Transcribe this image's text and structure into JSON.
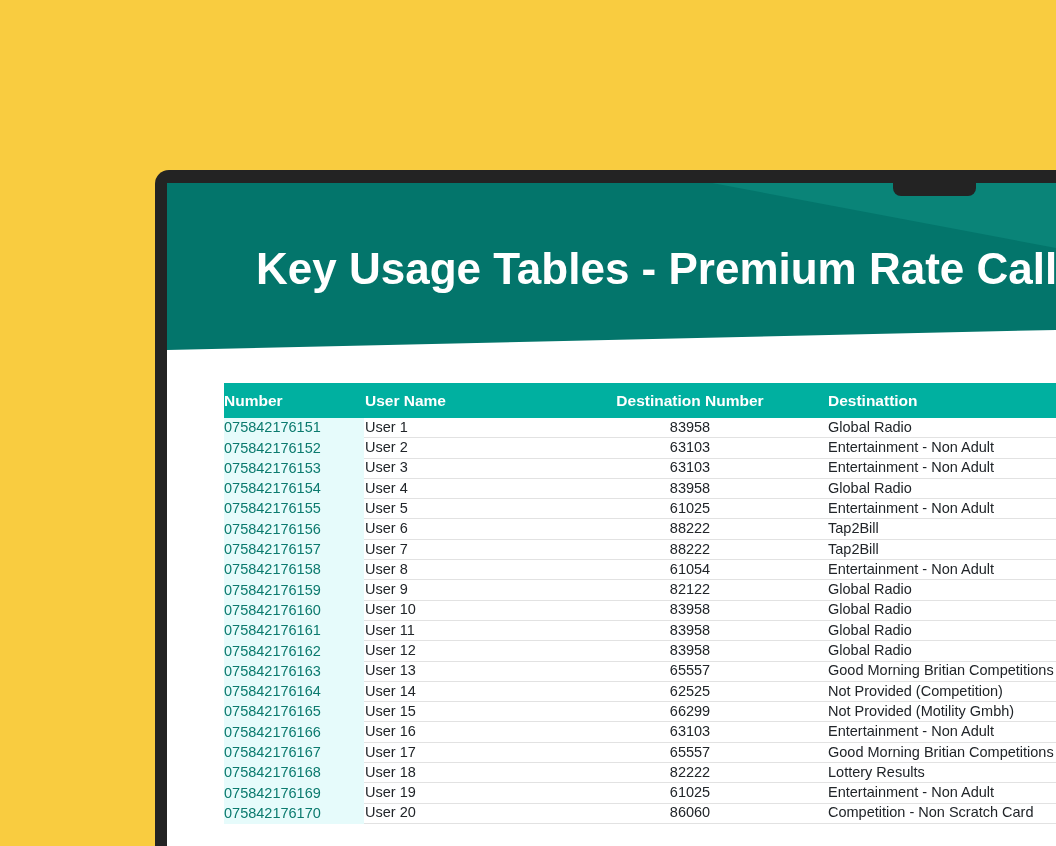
{
  "report": {
    "title": "Key Usage Tables - Premium Rate Call"
  },
  "table": {
    "columns": [
      "Number",
      "User Name",
      "Destination Number",
      "Destinattion"
    ],
    "rows": [
      [
        "075842176151",
        "User 1",
        "83958",
        "Global Radio"
      ],
      [
        "075842176152",
        "User 2",
        "63103",
        "Entertainment - Non Adult"
      ],
      [
        "075842176153",
        "User 3",
        "63103",
        "Entertainment - Non Adult"
      ],
      [
        "075842176154",
        "User 4",
        "83958",
        "Global Radio"
      ],
      [
        "075842176155",
        "User 5",
        "61025",
        "Entertainment - Non Adult"
      ],
      [
        "075842176156",
        "User 6",
        "88222",
        "Tap2Bill"
      ],
      [
        "075842176157",
        "User 7",
        "88222",
        "Tap2Bill"
      ],
      [
        "075842176158",
        "User 8",
        "61054",
        "Entertainment - Non Adult"
      ],
      [
        "075842176159",
        "User 9",
        "82122",
        "Global Radio"
      ],
      [
        "075842176160",
        "User 10",
        "83958",
        "Global Radio"
      ],
      [
        "075842176161",
        "User 11",
        "83958",
        "Global Radio"
      ],
      [
        "075842176162",
        "User 12",
        "83958",
        "Global Radio"
      ],
      [
        "075842176163",
        "User 13",
        "65557",
        "Good Morning Britian Competitions"
      ],
      [
        "075842176164",
        "User 14",
        "62525",
        "Not Provided (Competition)"
      ],
      [
        "075842176165",
        "User 15",
        "66299",
        "Not Provided (Motility Gmbh)"
      ],
      [
        "075842176166",
        "User 16",
        "63103",
        "Entertainment - Non Adult"
      ],
      [
        "075842176167",
        "User 17",
        "65557",
        "Good Morning Britian Competitions"
      ],
      [
        "075842176168",
        "User 18",
        "82222",
        "Lottery Results"
      ],
      [
        "075842176169",
        "User 19",
        "61025",
        "Entertainment - Non Adult"
      ],
      [
        "075842176170",
        "User 20",
        "86060",
        "Competition - Non Scratch Card"
      ]
    ]
  }
}
